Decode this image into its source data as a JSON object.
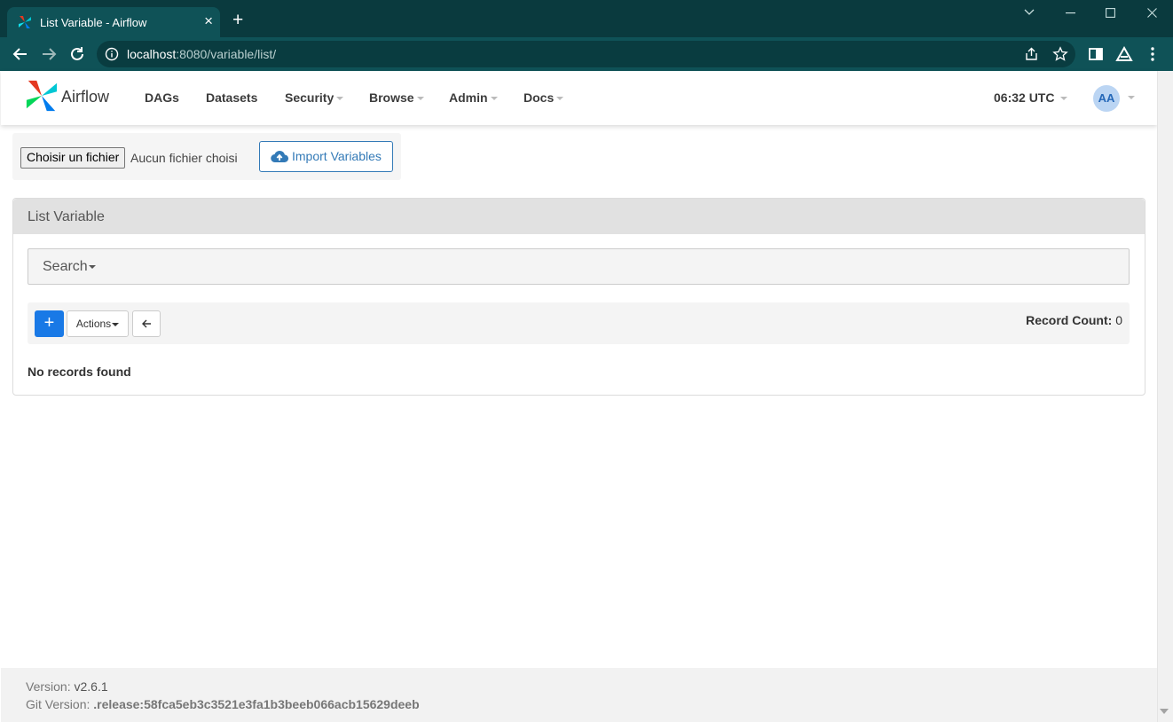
{
  "browser": {
    "tab_title": "List Variable - Airflow",
    "new_tab": "+",
    "url_host": "localhost",
    "url_path": ":8080/variable/list/"
  },
  "navbar": {
    "brand": "Airflow",
    "items": [
      {
        "label": "DAGs"
      },
      {
        "label": "Datasets"
      },
      {
        "label": "Security"
      },
      {
        "label": "Browse"
      },
      {
        "label": "Admin"
      },
      {
        "label": "Docs"
      }
    ],
    "time": "06:32 UTC",
    "avatar": "AA"
  },
  "import": {
    "file_button": "Choisir un fichier",
    "file_status": "Aucun fichier choisi",
    "import_button": "Import Variables"
  },
  "panel": {
    "title": "List Variable",
    "search_label": "Search",
    "add_button": "+",
    "actions_label": "Actions",
    "record_count_label": "Record Count:",
    "record_count_value": "0",
    "empty_message": "No records found"
  },
  "footer": {
    "version_label": "Version:",
    "version_value": "v2.6.1",
    "git_label": "Git Version:",
    "git_value": ".release:58fca5eb3c3521e3fa1b3beeb066acb15629deeb"
  },
  "colors": {
    "primary": "#1979e6",
    "link": "#337ab7",
    "browser_frame": "#0a3a3e",
    "browser_toolbar": "#0f5257"
  }
}
